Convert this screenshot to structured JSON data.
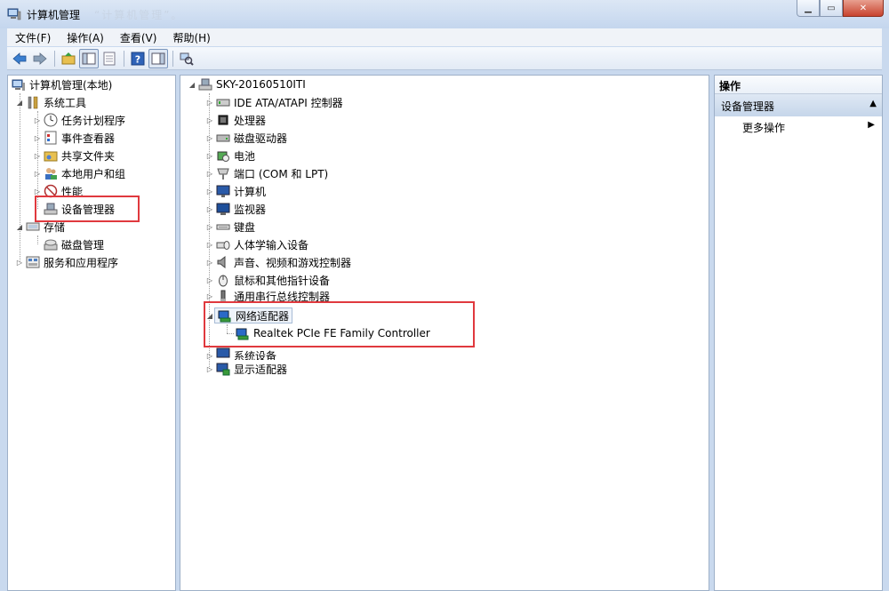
{
  "window": {
    "title": "计算机管理",
    "ghost_title": "“计算机管理”。",
    "minimize_icon": "minimize-icon",
    "maximize_icon": "maximize-icon",
    "close_icon": "close-icon"
  },
  "menu": [
    "文件(F)",
    "操作(A)",
    "查看(V)",
    "帮助(H)"
  ],
  "toolbar": {
    "icons": [
      "back-arrow-icon",
      "forward-arrow-icon",
      "up-folder-icon",
      "show-tree-icon",
      "export-list-icon",
      "help-icon",
      "action-pane-icon",
      "scan-hardware-icon"
    ]
  },
  "left_tree": {
    "root": "计算机管理(本地)",
    "system_tools": "系统工具",
    "task_scheduler": "任务计划程序",
    "event_viewer": "事件查看器",
    "shared_folders": "共享文件夹",
    "local_users": "本地用户和组",
    "performance": "性能",
    "device_manager": "设备管理器",
    "storage": "存储",
    "disk_management": "磁盘管理",
    "services": "服务和应用程序"
  },
  "device_tree": {
    "computer": "SKY-20160510ITI",
    "categories": [
      "IDE ATA/ATAPI 控制器",
      "处理器",
      "磁盘驱动器",
      "电池",
      "端口 (COM 和 LPT)",
      "计算机",
      "监视器",
      "键盘",
      "人体学输入设备",
      "声音、视频和游戏控制器",
      "鼠标和其他指针设备",
      "通用串行总线控制器",
      "网络适配器",
      "系统设备",
      "显示适配器"
    ],
    "network_child": "Realtek PCIe FE Family Controller"
  },
  "actions_pane": {
    "header": "操作",
    "section": "设备管理器",
    "more": "更多操作"
  },
  "colors": {
    "highlight_red": "#e0393e",
    "window_frame": "#c9d9ee"
  }
}
